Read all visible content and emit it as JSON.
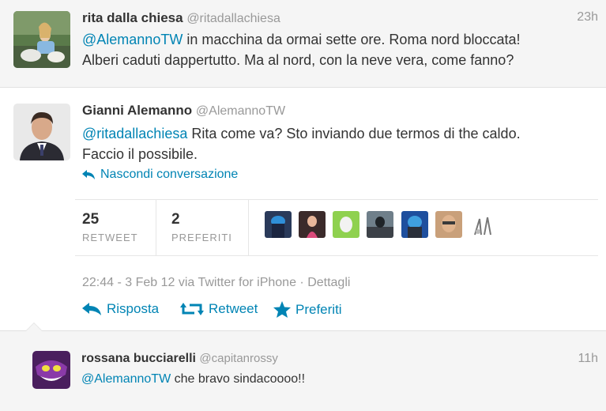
{
  "tweet1": {
    "name": "rita dalla chiesa",
    "handle": "@ritadallachiesa",
    "time": "23h",
    "mention": "@AlemannoTW",
    "text_line1_rest": " in macchina da ormai sette ore. Roma nord bloccata!",
    "text_line2": "Alberi caduti dappertutto. Ma al nord, con la neve vera, come fanno?"
  },
  "main": {
    "name": "Gianni Alemanno",
    "handle": "@AlemannoTW",
    "mention": "@ritadallachiesa",
    "text_line1_rest": " Rita come va? Sto inviando due termos di the caldo.",
    "text_line2": "Faccio il possibile.",
    "hide_conversation": "Nascondi conversazione",
    "retweet_count": "25",
    "retweet_label": "RETWEET",
    "favorite_count": "2",
    "favorite_label": "PREFERITI",
    "meta": "22:44 - 3 Feb 12 via Twitter for iPhone · Dettagli",
    "actions": {
      "reply": "Risposta",
      "retweet": "Retweet",
      "favorite": "Preferiti"
    }
  },
  "reply": {
    "name": "rossana bucciarelli",
    "handle": "@capitanrossy",
    "time": "11h",
    "mention": "@AlemannoTW",
    "text_rest": " che bravo sindacoooo!!"
  },
  "colors": {
    "link": "#0084b4",
    "muted": "#999999",
    "text": "#333333"
  },
  "icons": [
    "reply-arrow-icon",
    "retweet-icon",
    "star-icon"
  ]
}
